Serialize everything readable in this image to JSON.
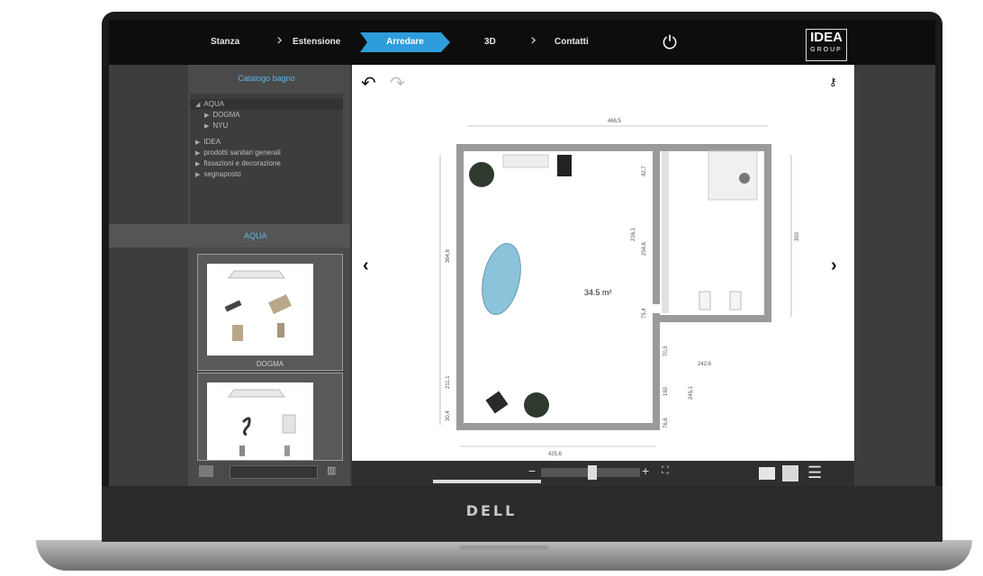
{
  "nav": {
    "steps": [
      "Stanza",
      "Estensione",
      "Arredare",
      "3D",
      "Contatti"
    ],
    "active_step": "Arredare",
    "logo_line1": "IDEA",
    "logo_line2": "GROUP"
  },
  "brand": "DELL",
  "sidebar": {
    "category_header": "Catalogo bagno",
    "tree": [
      {
        "label": "AQUA",
        "expanded": true
      },
      {
        "label": "DOGMA"
      },
      {
        "label": "NYU"
      },
      {
        "label": "IDEA"
      },
      {
        "label": "prodotti sanitari generali"
      },
      {
        "label": "fissazioni e decorazione"
      },
      {
        "label": "segnaposto"
      }
    ],
    "section_title": "AQUA",
    "cards": [
      {
        "caption": "DOGMA"
      },
      {
        "caption": ""
      }
    ]
  },
  "canvas": {
    "area_label": "34.5 m²",
    "dimensions": [
      "466,5",
      "425,6",
      "364,6",
      "211,1",
      "30,4",
      "42,7",
      "254,6",
      "75,4",
      "70,5",
      "150",
      "76,6",
      "242,6",
      "350",
      "245,1",
      "216,1"
    ]
  },
  "colors": {
    "accent": "#2e9ddc",
    "topbar": "#0d0d0d",
    "panel": "#4a4a4a"
  }
}
